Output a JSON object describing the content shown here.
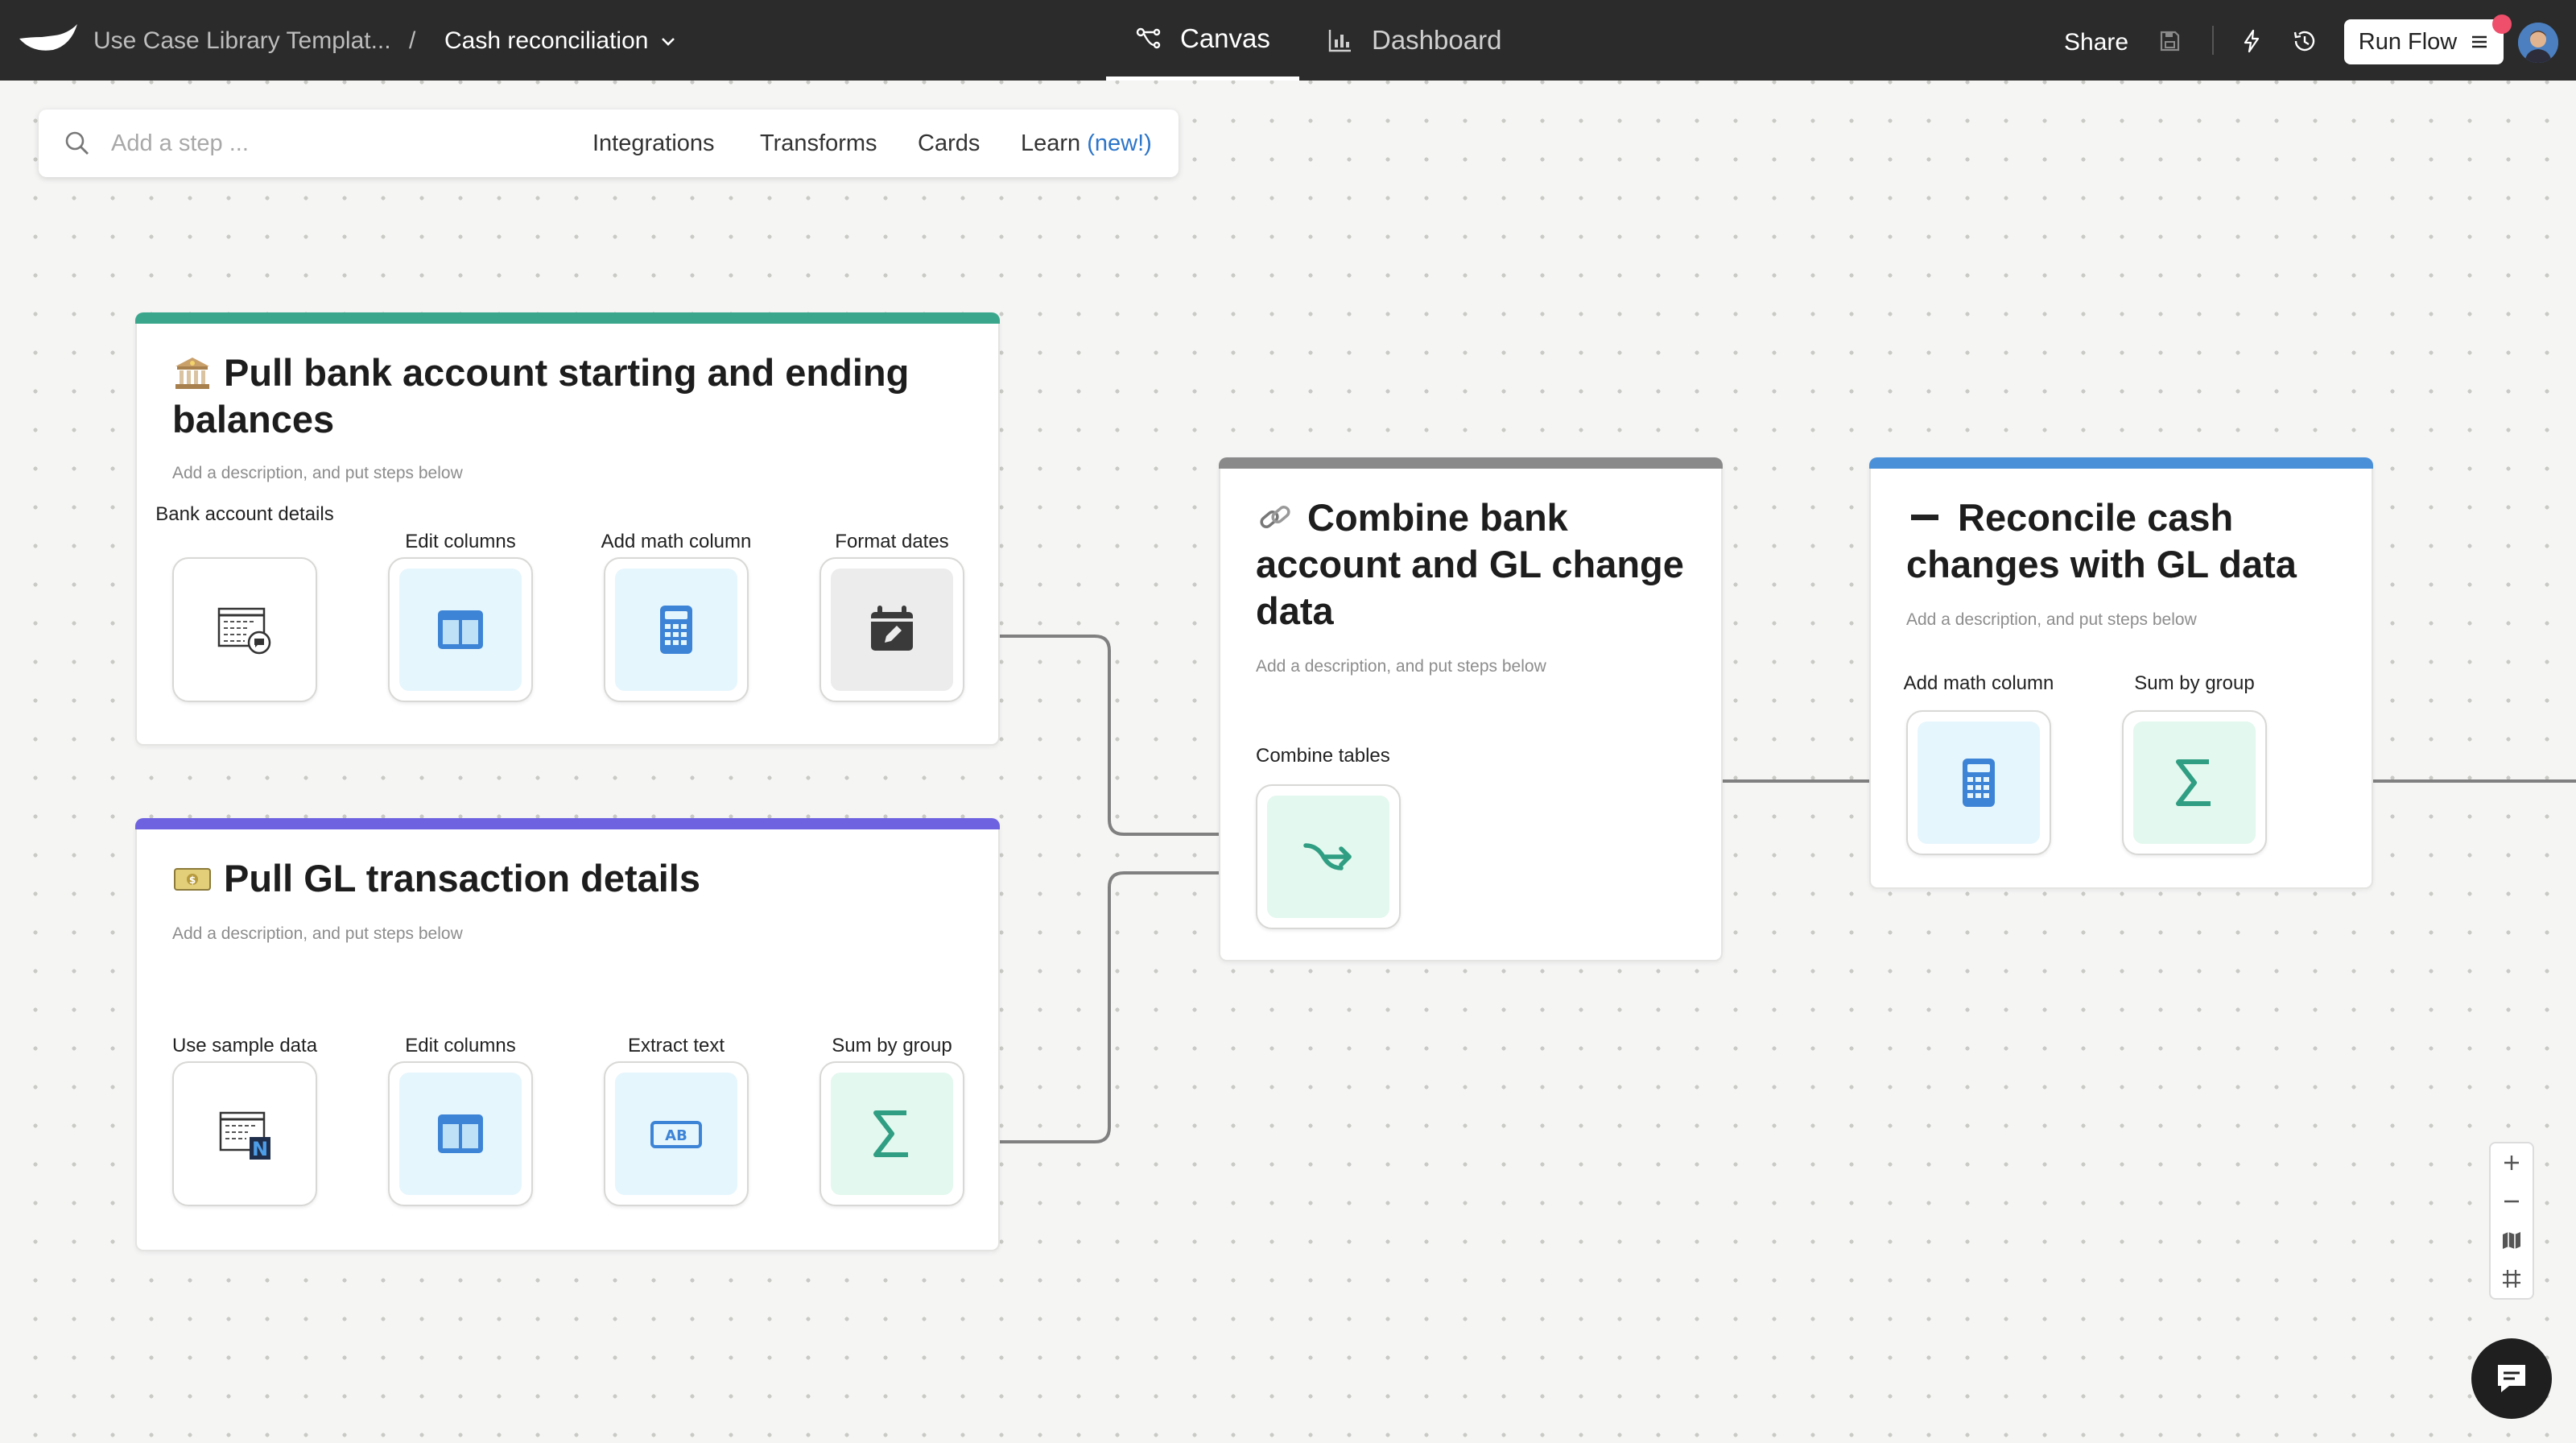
{
  "header": {
    "breadcrumb_parent": "Use Case Library Templat...",
    "breadcrumb_separator": "/",
    "flow_name": "Cash reconciliation",
    "tabs": [
      {
        "label": "Canvas",
        "icon": "flow-icon",
        "active": true
      },
      {
        "label": "Dashboard",
        "icon": "bar-chart-icon",
        "active": false
      }
    ],
    "share_label": "Share",
    "run_flow_label": "Run Flow"
  },
  "search": {
    "placeholder": "Add a step ...",
    "links": [
      "Integrations",
      "Transforms",
      "Cards"
    ],
    "learn_label": "Learn",
    "learn_badge": "(new!)"
  },
  "cards": [
    {
      "title": "Pull bank account starting and ending balances",
      "emoji": "bank-icon",
      "description": "Add a description, and put steps below",
      "accent": "#3aa78d",
      "steps": [
        {
          "label": "Bank account details",
          "icon": "table-chat-icon"
        },
        {
          "label": "Edit columns",
          "icon": "columns-icon"
        },
        {
          "label": "Add math column",
          "icon": "calculator-icon"
        },
        {
          "label": "Format dates",
          "icon": "calendar-edit-icon"
        }
      ]
    },
    {
      "title": "Pull GL transaction details",
      "emoji": "money-icon",
      "description": "Add a description, and put steps below",
      "accent": "#6e62e0",
      "steps": [
        {
          "label": "Use sample data",
          "icon": "table-n-icon"
        },
        {
          "label": "Edit columns",
          "icon": "columns-icon"
        },
        {
          "label": "Extract text",
          "icon": "ab-text-icon"
        },
        {
          "label": "Sum by group",
          "icon": "sigma-icon"
        }
      ]
    },
    {
      "title": "Combine bank account and GL change data",
      "emoji": "link-icon",
      "description": "Add a description, and put steps below",
      "accent": "#8a8a8a",
      "steps": [
        {
          "label": "Combine tables",
          "icon": "merge-icon"
        }
      ]
    },
    {
      "title": "Reconcile cash changes with GL data",
      "emoji": "minus-icon",
      "description": "Add a description, and put steps below",
      "accent": "#4a90d9",
      "steps": [
        {
          "label": "Add math column",
          "icon": "calculator-icon"
        },
        {
          "label": "Sum by group",
          "icon": "sigma-icon"
        }
      ]
    }
  ],
  "colors": {
    "topbar": "#2b2b2b",
    "teal": "#2f9e82",
    "blue": "#3d84d6",
    "tile_blue": "#e6f6fd",
    "tile_green": "#e3f8ee",
    "tile_gray": "#ececec"
  }
}
